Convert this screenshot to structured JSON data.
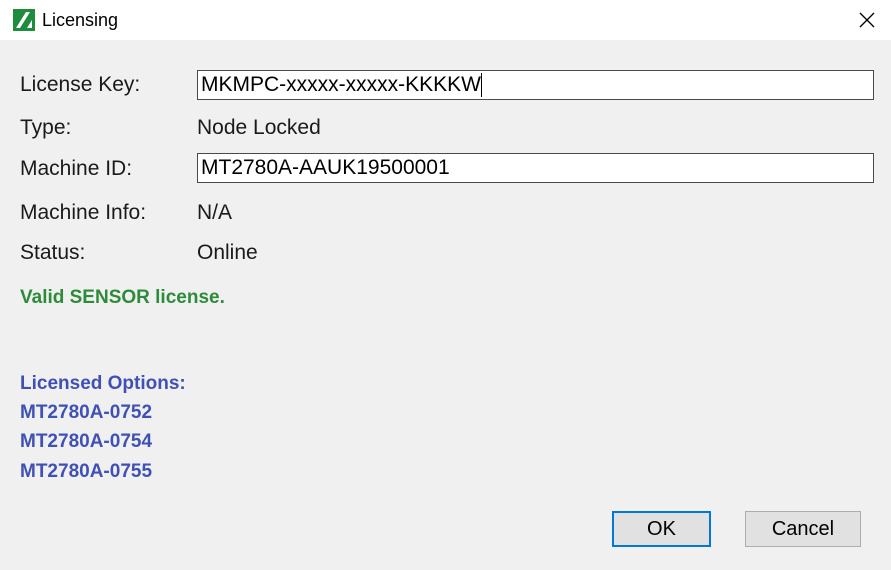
{
  "window": {
    "title": "Licensing",
    "icon": "anritsu-logo-icon",
    "close_icon": "close-icon"
  },
  "form": {
    "license_key": {
      "label": "License Key:",
      "value": "MKMPC-xxxxx-xxxxx-KKKKW"
    },
    "type": {
      "label": "Type:",
      "value": "Node Locked"
    },
    "machine_id": {
      "label": "Machine ID:",
      "value": "MT2780A-AAUK19500001"
    },
    "machine_info": {
      "label": "Machine Info:",
      "value": "N/A"
    },
    "status": {
      "label": "Status:",
      "value": "Online"
    }
  },
  "validation": {
    "message": "Valid SENSOR license.",
    "color": "#2e8b3a"
  },
  "options": {
    "heading": "Licensed Options:",
    "items": [
      "MT2780A-0752",
      "MT2780A-0754",
      "MT2780A-0755"
    ],
    "color": "#3f51b5"
  },
  "buttons": {
    "ok": "OK",
    "cancel": "Cancel"
  }
}
